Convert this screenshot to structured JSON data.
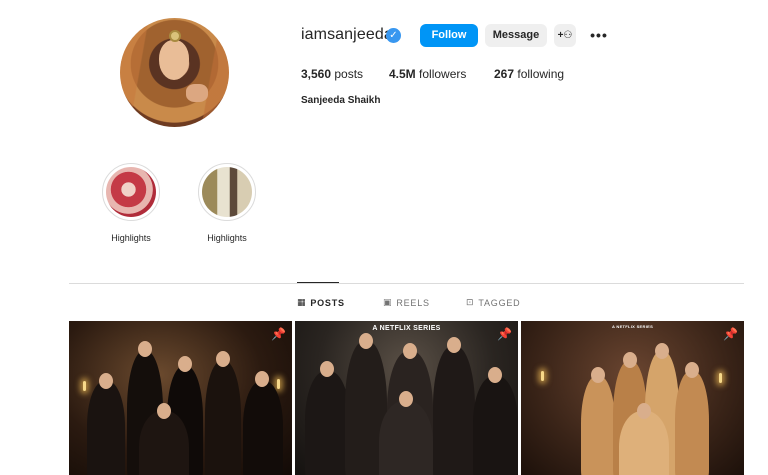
{
  "profile": {
    "username": "iamsanjeeda",
    "verified_glyph": "✓",
    "follow_label": "Follow",
    "message_label": "Message",
    "add_user_glyph": "+⚇",
    "more_glyph": "•••",
    "posts_count": "3,560",
    "posts_label": "posts",
    "followers_count": "4.5M",
    "followers_label": "followers",
    "following_count": "267",
    "following_label": "following",
    "full_name": "Sanjeeda Shaikh"
  },
  "highlights": [
    {
      "label": "Highlights"
    },
    {
      "label": "Highlights"
    }
  ],
  "tabs": [
    {
      "label": "POSTS",
      "icon": "grid-icon",
      "glyph": "▦"
    },
    {
      "label": "REELS",
      "icon": "reels-icon",
      "glyph": "▣"
    },
    {
      "label": "TAGGED",
      "icon": "tagged-icon",
      "glyph": "⊡"
    }
  ],
  "posts": [
    {
      "pin_glyph": "📌",
      "overlay_text": ""
    },
    {
      "pin_glyph": "📌",
      "overlay_text": "A NETFLIX SERIES"
    },
    {
      "pin_glyph": "📌",
      "overlay_text": "A NETFLIX SERIES"
    }
  ],
  "colors": {
    "accent": "#0095f6",
    "verified": "#3897f0",
    "text": "#262626",
    "muted": "#737373",
    "divider": "#dbdbdb"
  }
}
